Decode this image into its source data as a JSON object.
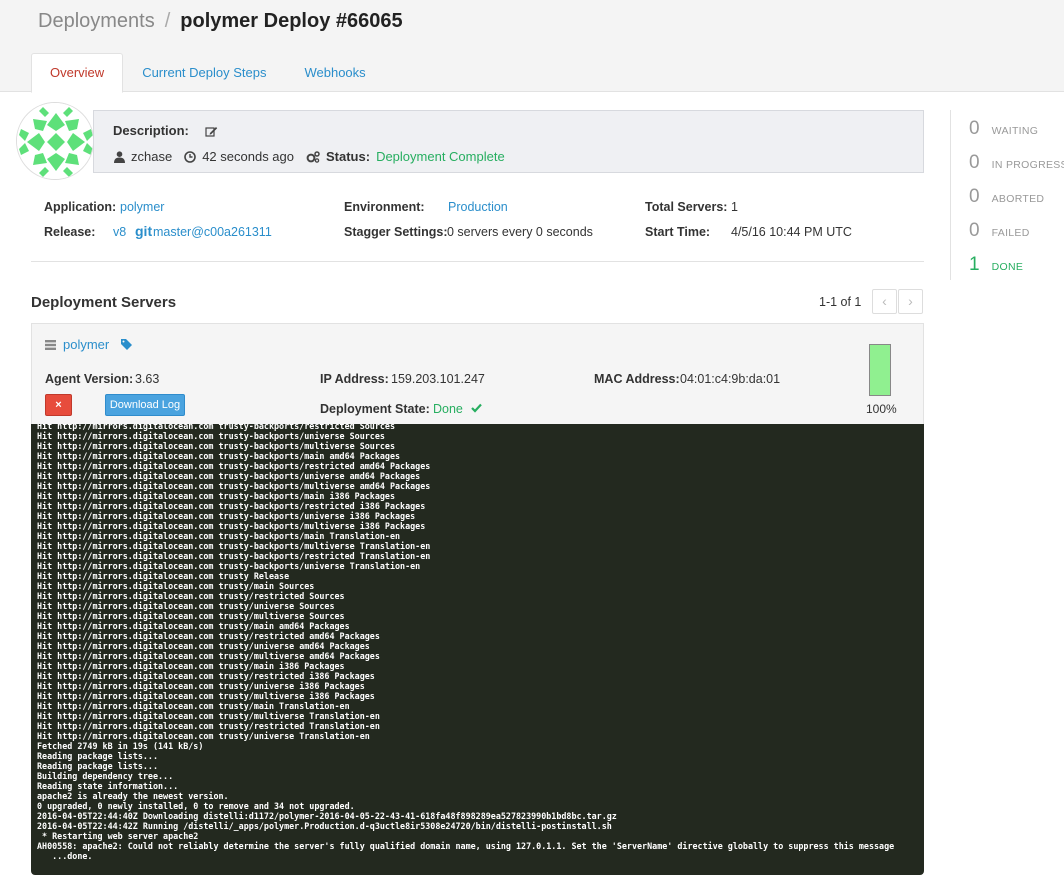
{
  "breadcrumb": {
    "root": "Deployments",
    "separator": "/",
    "title": "polymer Deploy #66065"
  },
  "tabs": [
    {
      "label": "Overview",
      "active": true
    },
    {
      "label": "Current Deploy Steps",
      "active": false
    },
    {
      "label": "Webhooks",
      "active": false
    }
  ],
  "description": {
    "label": "Description:",
    "user": "zchase",
    "time": "42 seconds ago",
    "status_label": "Status:",
    "status_value": "Deployment Complete"
  },
  "info": {
    "application_label": "Application:",
    "application_value": "polymer",
    "release_label": "Release:",
    "release_value": "v8",
    "git_label": "git",
    "git_ref": "master@c00a261311",
    "environment_label": "Environment:",
    "environment_value": "Production",
    "stagger_label": "Stagger Settings:",
    "stagger_value": "0 servers every 0 seconds",
    "total_servers_label": "Total Servers:",
    "total_servers_value": "1",
    "start_time_label": "Start Time:",
    "start_time_value": "4/5/16 10:44 PM UTC"
  },
  "servers_section": {
    "title": "Deployment Servers",
    "pagination": "1-1 of 1",
    "prev_icon": "‹",
    "next_icon": "›"
  },
  "server": {
    "name": "polymer",
    "agent_version_label": "Agent Version:",
    "agent_version_value": "3.63",
    "ip_label": "IP Address:",
    "ip_value": "159.203.101.247",
    "mac_label": "MAC Address:",
    "mac_value": "04:01:c4:9b:da:01",
    "state_label": "Deployment State:",
    "state_value": "Done",
    "remove_label": "×",
    "download_label": "Download Log",
    "progress_percent": 100,
    "progress_text": "100%"
  },
  "log_lines": [
    "Hit http://mirrors.digitalocean.com trusty-backports/restricted Sources",
    "Hit http://mirrors.digitalocean.com trusty-backports/universe Sources",
    "Hit http://mirrors.digitalocean.com trusty-backports/multiverse Sources",
    "Hit http://mirrors.digitalocean.com trusty-backports/main amd64 Packages",
    "Hit http://mirrors.digitalocean.com trusty-backports/restricted amd64 Packages",
    "Hit http://mirrors.digitalocean.com trusty-backports/universe amd64 Packages",
    "Hit http://mirrors.digitalocean.com trusty-backports/multiverse amd64 Packages",
    "Hit http://mirrors.digitalocean.com trusty-backports/main i386 Packages",
    "Hit http://mirrors.digitalocean.com trusty-backports/restricted i386 Packages",
    "Hit http://mirrors.digitalocean.com trusty-backports/universe i386 Packages",
    "Hit http://mirrors.digitalocean.com trusty-backports/multiverse i386 Packages",
    "Hit http://mirrors.digitalocean.com trusty-backports/main Translation-en",
    "Hit http://mirrors.digitalocean.com trusty-backports/multiverse Translation-en",
    "Hit http://mirrors.digitalocean.com trusty-backports/restricted Translation-en",
    "Hit http://mirrors.digitalocean.com trusty-backports/universe Translation-en",
    "Hit http://mirrors.digitalocean.com trusty Release",
    "Hit http://mirrors.digitalocean.com trusty/main Sources",
    "Hit http://mirrors.digitalocean.com trusty/restricted Sources",
    "Hit http://mirrors.digitalocean.com trusty/universe Sources",
    "Hit http://mirrors.digitalocean.com trusty/multiverse Sources",
    "Hit http://mirrors.digitalocean.com trusty/main amd64 Packages",
    "Hit http://mirrors.digitalocean.com trusty/restricted amd64 Packages",
    "Hit http://mirrors.digitalocean.com trusty/universe amd64 Packages",
    "Hit http://mirrors.digitalocean.com trusty/multiverse amd64 Packages",
    "Hit http://mirrors.digitalocean.com trusty/main i386 Packages",
    "Hit http://mirrors.digitalocean.com trusty/restricted i386 Packages",
    "Hit http://mirrors.digitalocean.com trusty/universe i386 Packages",
    "Hit http://mirrors.digitalocean.com trusty/multiverse i386 Packages",
    "Hit http://mirrors.digitalocean.com trusty/main Translation-en",
    "Hit http://mirrors.digitalocean.com trusty/multiverse Translation-en",
    "Hit http://mirrors.digitalocean.com trusty/restricted Translation-en",
    "Hit http://mirrors.digitalocean.com trusty/universe Translation-en",
    "Fetched 2749 kB in 19s (141 kB/s)",
    "Reading package lists...",
    "Reading package lists...",
    "Building dependency tree...",
    "Reading state information...",
    "apache2 is already the newest version.",
    "0 upgraded, 0 newly installed, 0 to remove and 34 not upgraded.",
    "2016-04-05T22:44:40Z Downloading distelli:d1172/polymer-2016-04-05-22-43-41-618fa48f898289ea527823990b1bd8bc.tar.gz",
    "2016-04-05T22:44:42Z Running /distelli/_apps/polymer.Production.d-q3uctle8ir5308e24720/bin/distelli-postinstall.sh",
    " * Restarting web server apache2",
    "AH00558: apache2: Could not reliably determine the server's fully qualified domain name, using 127.0.1.1. Set the 'ServerName' directive globally to suppress this message",
    "   ...done."
  ],
  "stats": [
    {
      "count": "0",
      "label": "WAITING"
    },
    {
      "count": "0",
      "label": "IN PROGRESS"
    },
    {
      "count": "0",
      "label": "ABORTED"
    },
    {
      "count": "0",
      "label": "FAILED"
    },
    {
      "count": "1",
      "label": "DONE"
    }
  ],
  "colors": {
    "link": "#2a8ecb",
    "success": "#27ae60",
    "active_tab": "#c0392b",
    "log_bg": "#23291f",
    "progress_fill": "#90f090"
  },
  "icons": [
    "edit-icon",
    "user-icon",
    "clock-icon",
    "gears-icon",
    "server-icon",
    "tag-icon",
    "check-icon",
    "chevron-left-icon",
    "chevron-right-icon"
  ]
}
